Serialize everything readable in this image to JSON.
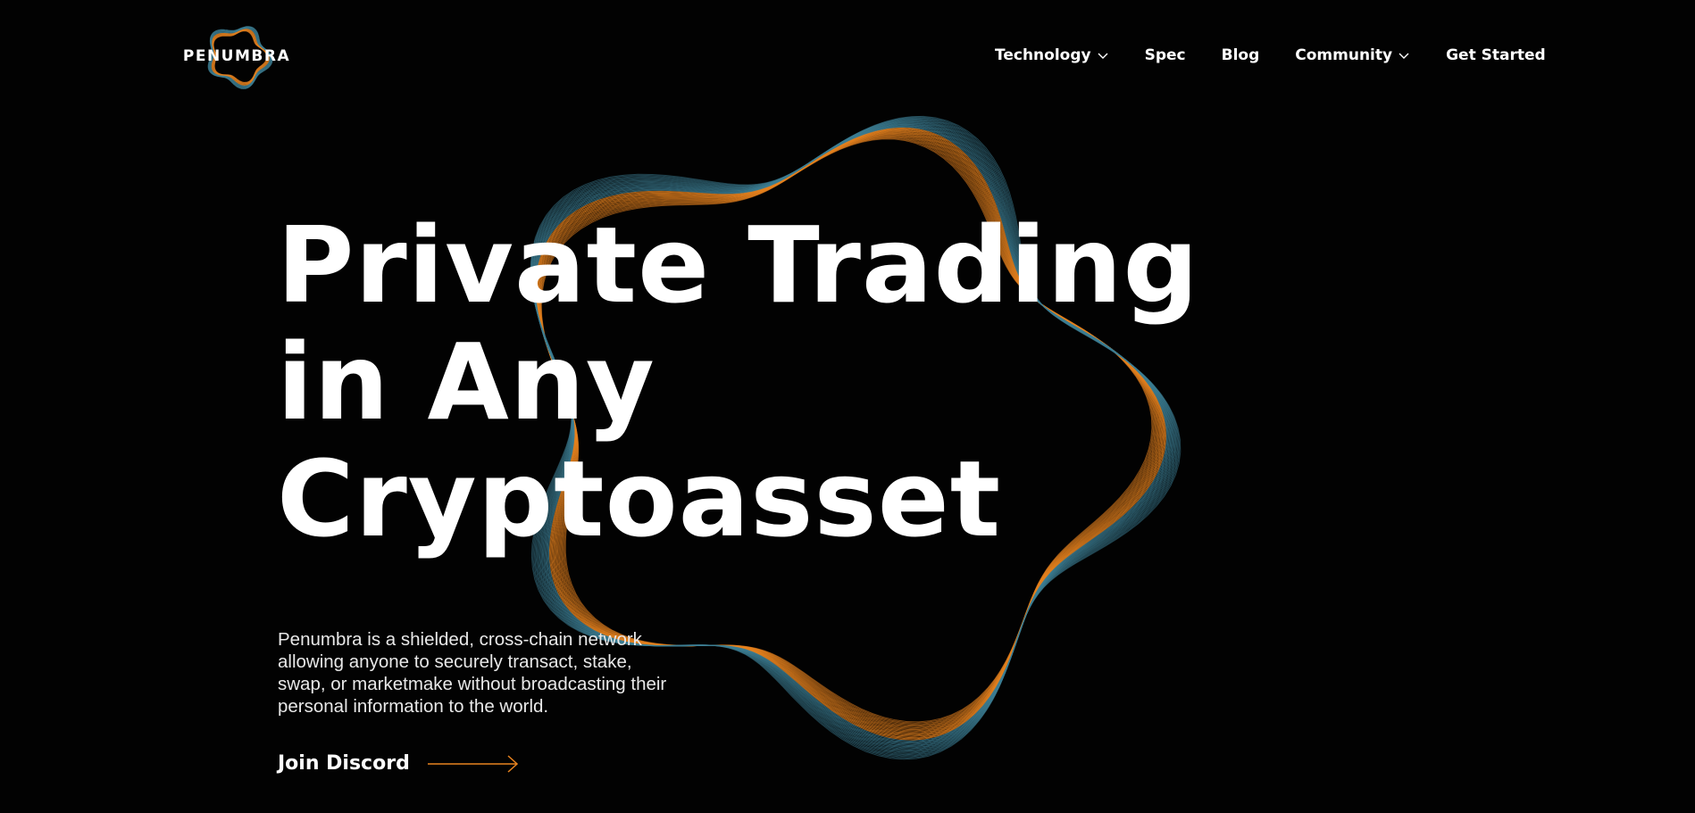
{
  "brand": {
    "name": "PENUMBRA",
    "accent_orange": "#e8831f",
    "accent_teal": "#3d7f95",
    "background": "#020202"
  },
  "nav": {
    "items": [
      {
        "label": "Technology",
        "has_dropdown": true,
        "icon": "chevron-down-icon"
      },
      {
        "label": "Spec",
        "has_dropdown": false
      },
      {
        "label": "Blog",
        "has_dropdown": false
      },
      {
        "label": "Community",
        "has_dropdown": true,
        "icon": "chevron-down-icon"
      },
      {
        "label": "Get Started",
        "has_dropdown": false
      }
    ]
  },
  "hero": {
    "headline_lines": [
      "Private Trading",
      "in Any",
      "Cryptoasset"
    ],
    "description": "Penumbra is a shielded, cross-chain network allowing anyone to securely transact, stake, swap, or marketmake without broadcasting their personal information to the world.",
    "cta_label": "Join Discord",
    "cta_icon": "arrow-right-icon"
  }
}
